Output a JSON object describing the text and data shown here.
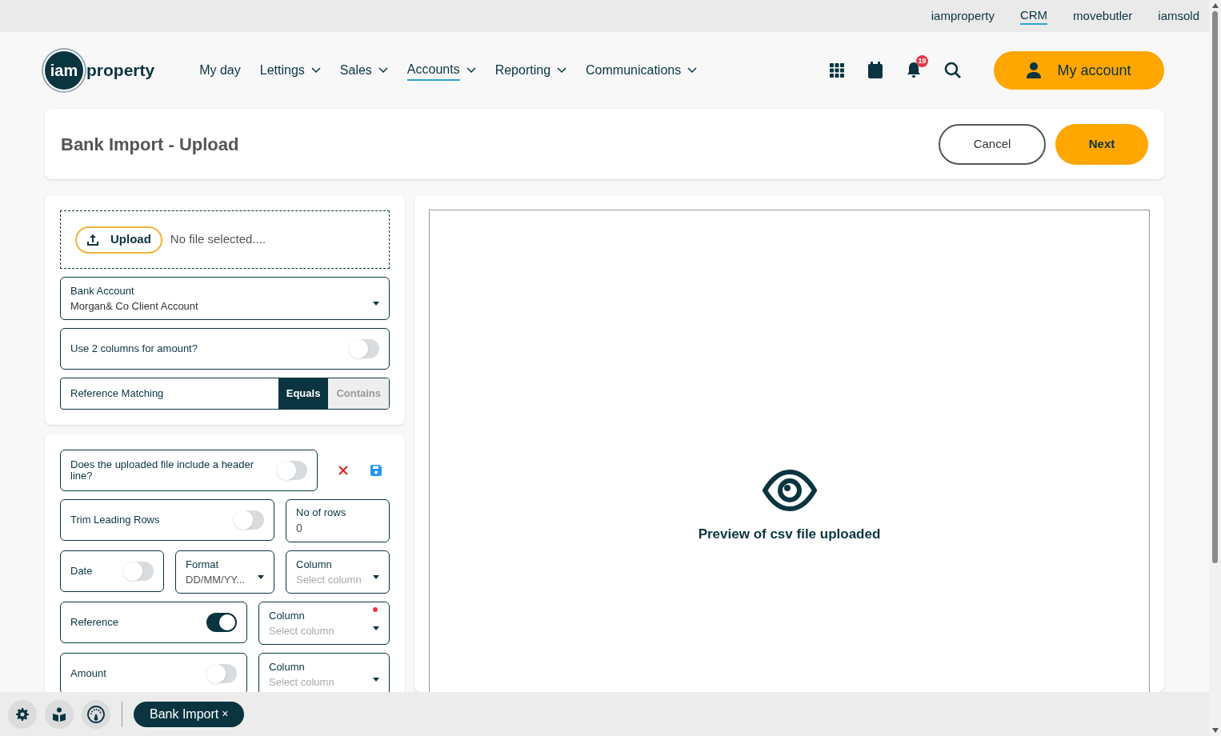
{
  "top_links": [
    {
      "label": "iamproperty",
      "selected": false
    },
    {
      "label": "CRM",
      "selected": true
    },
    {
      "label": "movebutler",
      "selected": false
    },
    {
      "label": "iamsold",
      "selected": false
    }
  ],
  "logo": {
    "badge": "iam",
    "word": "property"
  },
  "nav": [
    {
      "label": "My day",
      "dropdown": false,
      "selected": false
    },
    {
      "label": "Lettings",
      "dropdown": true,
      "selected": false
    },
    {
      "label": "Sales",
      "dropdown": true,
      "selected": false
    },
    {
      "label": "Accounts",
      "dropdown": true,
      "selected": true
    },
    {
      "label": "Reporting",
      "dropdown": true,
      "selected": false
    },
    {
      "label": "Communications",
      "dropdown": true,
      "selected": false
    }
  ],
  "notification_count": "19",
  "account_button": "My account",
  "page": {
    "title": "Bank Import - Upload",
    "buttons": [
      {
        "label": "Cancel",
        "kind": "outline"
      },
      {
        "label": "Next",
        "kind": "primary"
      }
    ]
  },
  "upload": {
    "button": "Upload",
    "status": "No file selected...."
  },
  "bank_account": {
    "label": "Bank Account",
    "value": "Morgan& Co Client Account"
  },
  "two_columns": {
    "label": "Use 2 columns for amount?",
    "on": false
  },
  "reference_matching": {
    "label": "Reference Matching",
    "options": [
      {
        "label": "Equals",
        "selected": true
      },
      {
        "label": "Contains",
        "selected": false
      }
    ]
  },
  "mapping_rows": [
    [
      {
        "kind": "toggle",
        "label": "Does the uploaded file include a header line?",
        "on": false
      }
    ],
    [
      {
        "kind": "toggle",
        "label": "Trim Leading Rows",
        "on": false
      },
      {
        "kind": "input",
        "label": "No of rows",
        "value": "0"
      }
    ],
    [
      {
        "kind": "toggle",
        "label": "Date",
        "on": false
      },
      {
        "kind": "select",
        "label": "Format",
        "value": "DD/MM/YY...",
        "required": false
      },
      {
        "kind": "select",
        "label": "Column",
        "placeholder": "Select column",
        "required": false
      }
    ],
    [
      {
        "kind": "toggle",
        "label": "Reference",
        "on": true
      },
      {
        "kind": "select",
        "label": "Column",
        "placeholder": "Select column",
        "required": true
      }
    ],
    [
      {
        "kind": "toggle",
        "label": "Amount",
        "on": false
      },
      {
        "kind": "select",
        "label": "Column",
        "placeholder": "Select column",
        "required": false
      }
    ]
  ],
  "preview": {
    "caption": "Preview of csv file uploaded"
  },
  "bottom_bar": {
    "tabs": [
      {
        "label": "Bank Import",
        "close": "×"
      }
    ]
  }
}
